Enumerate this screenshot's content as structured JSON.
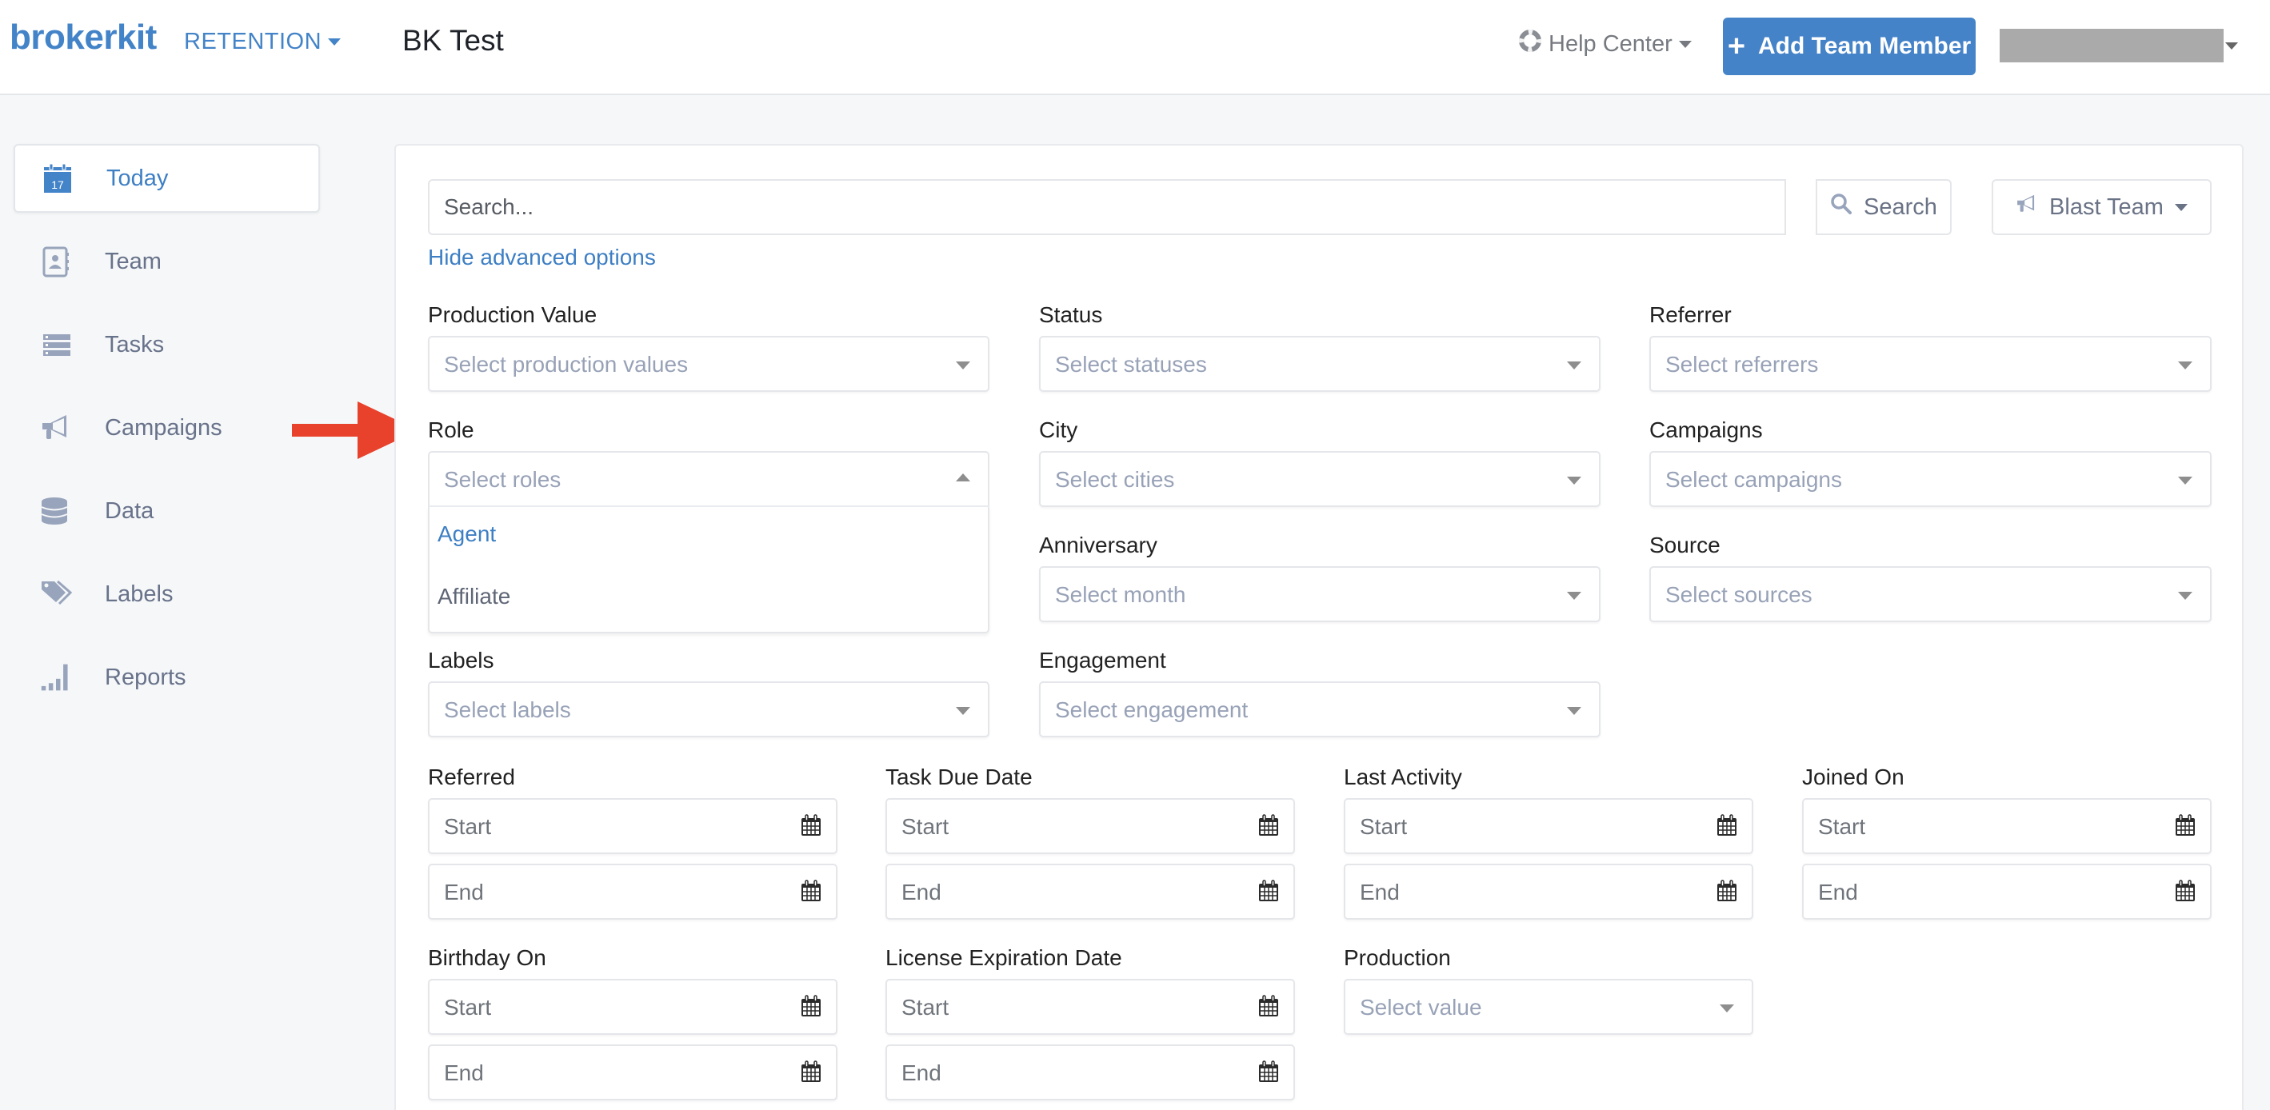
{
  "header": {
    "logo": "brokerkit",
    "product_switch": "RETENTION",
    "org_name": "BK Test",
    "help_center": "Help Center",
    "add_member_button": "Add Team Member",
    "user_name_redacted": ""
  },
  "sidebar": {
    "items": [
      {
        "label": "Today",
        "icon": "calendar-17-icon",
        "active": true
      },
      {
        "label": "Team",
        "icon": "contact-book-icon",
        "active": false
      },
      {
        "label": "Tasks",
        "icon": "list-icon",
        "active": false
      },
      {
        "label": "Campaigns",
        "icon": "megaphone-icon",
        "active": false
      },
      {
        "label": "Data",
        "icon": "database-icon",
        "active": false
      },
      {
        "label": "Labels",
        "icon": "tags-icon",
        "active": false
      },
      {
        "label": "Reports",
        "icon": "signal-bars-icon",
        "active": false
      }
    ],
    "today_icon_number": "17"
  },
  "search": {
    "placeholder": "Search...",
    "button_label": "Search",
    "blast_button_label": "Blast Team",
    "advanced_toggle": "Hide advanced options"
  },
  "filters": {
    "production_value": {
      "label": "Production Value",
      "placeholder": "Select production values"
    },
    "status": {
      "label": "Status",
      "placeholder": "Select statuses"
    },
    "referrer": {
      "label": "Referrer",
      "placeholder": "Select referrers"
    },
    "role": {
      "label": "Role",
      "placeholder": "Select roles",
      "open": true,
      "options": [
        "Agent",
        "Affiliate"
      ],
      "highlighted": "Agent"
    },
    "city": {
      "label": "City",
      "placeholder": "Select cities"
    },
    "campaigns": {
      "label": "Campaigns",
      "placeholder": "Select campaigns"
    },
    "anniversary": {
      "label": "Anniversary",
      "placeholder": "Select month"
    },
    "source": {
      "label": "Source",
      "placeholder": "Select sources"
    },
    "labels": {
      "label": "Labels",
      "placeholder": "Select labels"
    },
    "engagement": {
      "label": "Engagement",
      "placeholder": "Select engagement"
    },
    "production": {
      "label": "Production",
      "placeholder": "Select value"
    }
  },
  "date_filters": [
    {
      "label": "Referred",
      "start": "Start",
      "end": "End"
    },
    {
      "label": "Task Due Date",
      "start": "Start",
      "end": "End"
    },
    {
      "label": "Last Activity",
      "start": "Start",
      "end": "End"
    },
    {
      "label": "Joined On",
      "start": "Start",
      "end": "End"
    },
    {
      "label": "Birthday On",
      "start": "Start",
      "end": "End"
    },
    {
      "label": "License Expiration Date",
      "start": "Start",
      "end": "End"
    }
  ],
  "colors": {
    "brand_blue": "#4583c8",
    "annotation_arrow": "#e8412c",
    "placeholder": "#98a2b7",
    "sidebar_icon": "#98a4bc"
  }
}
